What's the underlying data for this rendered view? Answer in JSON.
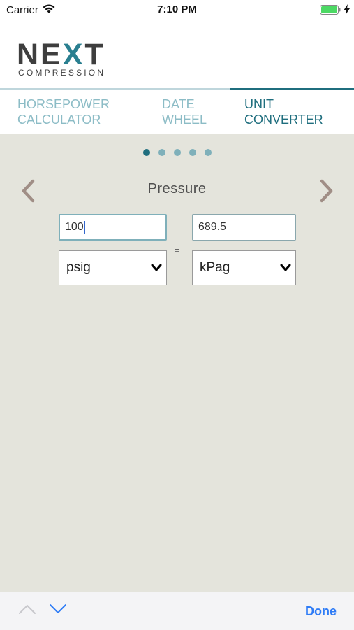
{
  "status": {
    "carrier": "Carrier",
    "time": "7:10 PM",
    "icons": [
      "wifi-icon",
      "battery-icon",
      "charging-icon"
    ]
  },
  "logo": {
    "word_pre": "NE",
    "word_x": "X",
    "word_post": "T",
    "sub": "COMPRESSION"
  },
  "tabs": [
    {
      "line1": "HORSEPOWER",
      "line2": "CALCULATOR",
      "active": false
    },
    {
      "line1": "DATE",
      "line2": "WHEEL",
      "active": false
    },
    {
      "line1": "UNIT",
      "line2": "CONVERTER",
      "active": true
    }
  ],
  "pager": {
    "count": 5,
    "active_index": 0
  },
  "converter": {
    "title": "Pressure",
    "input_value": "100",
    "output_value": "689.5",
    "from_unit": "psig",
    "to_unit": "kPag",
    "equals": "="
  },
  "keyboard_toolbar": {
    "done_label": "Done"
  },
  "colors": {
    "accent": "#1f6e7e",
    "tab_inactive": "#8cbcc6",
    "background": "#e4e4dc",
    "arrow": "#a08e86",
    "done": "#2f7cf6"
  }
}
